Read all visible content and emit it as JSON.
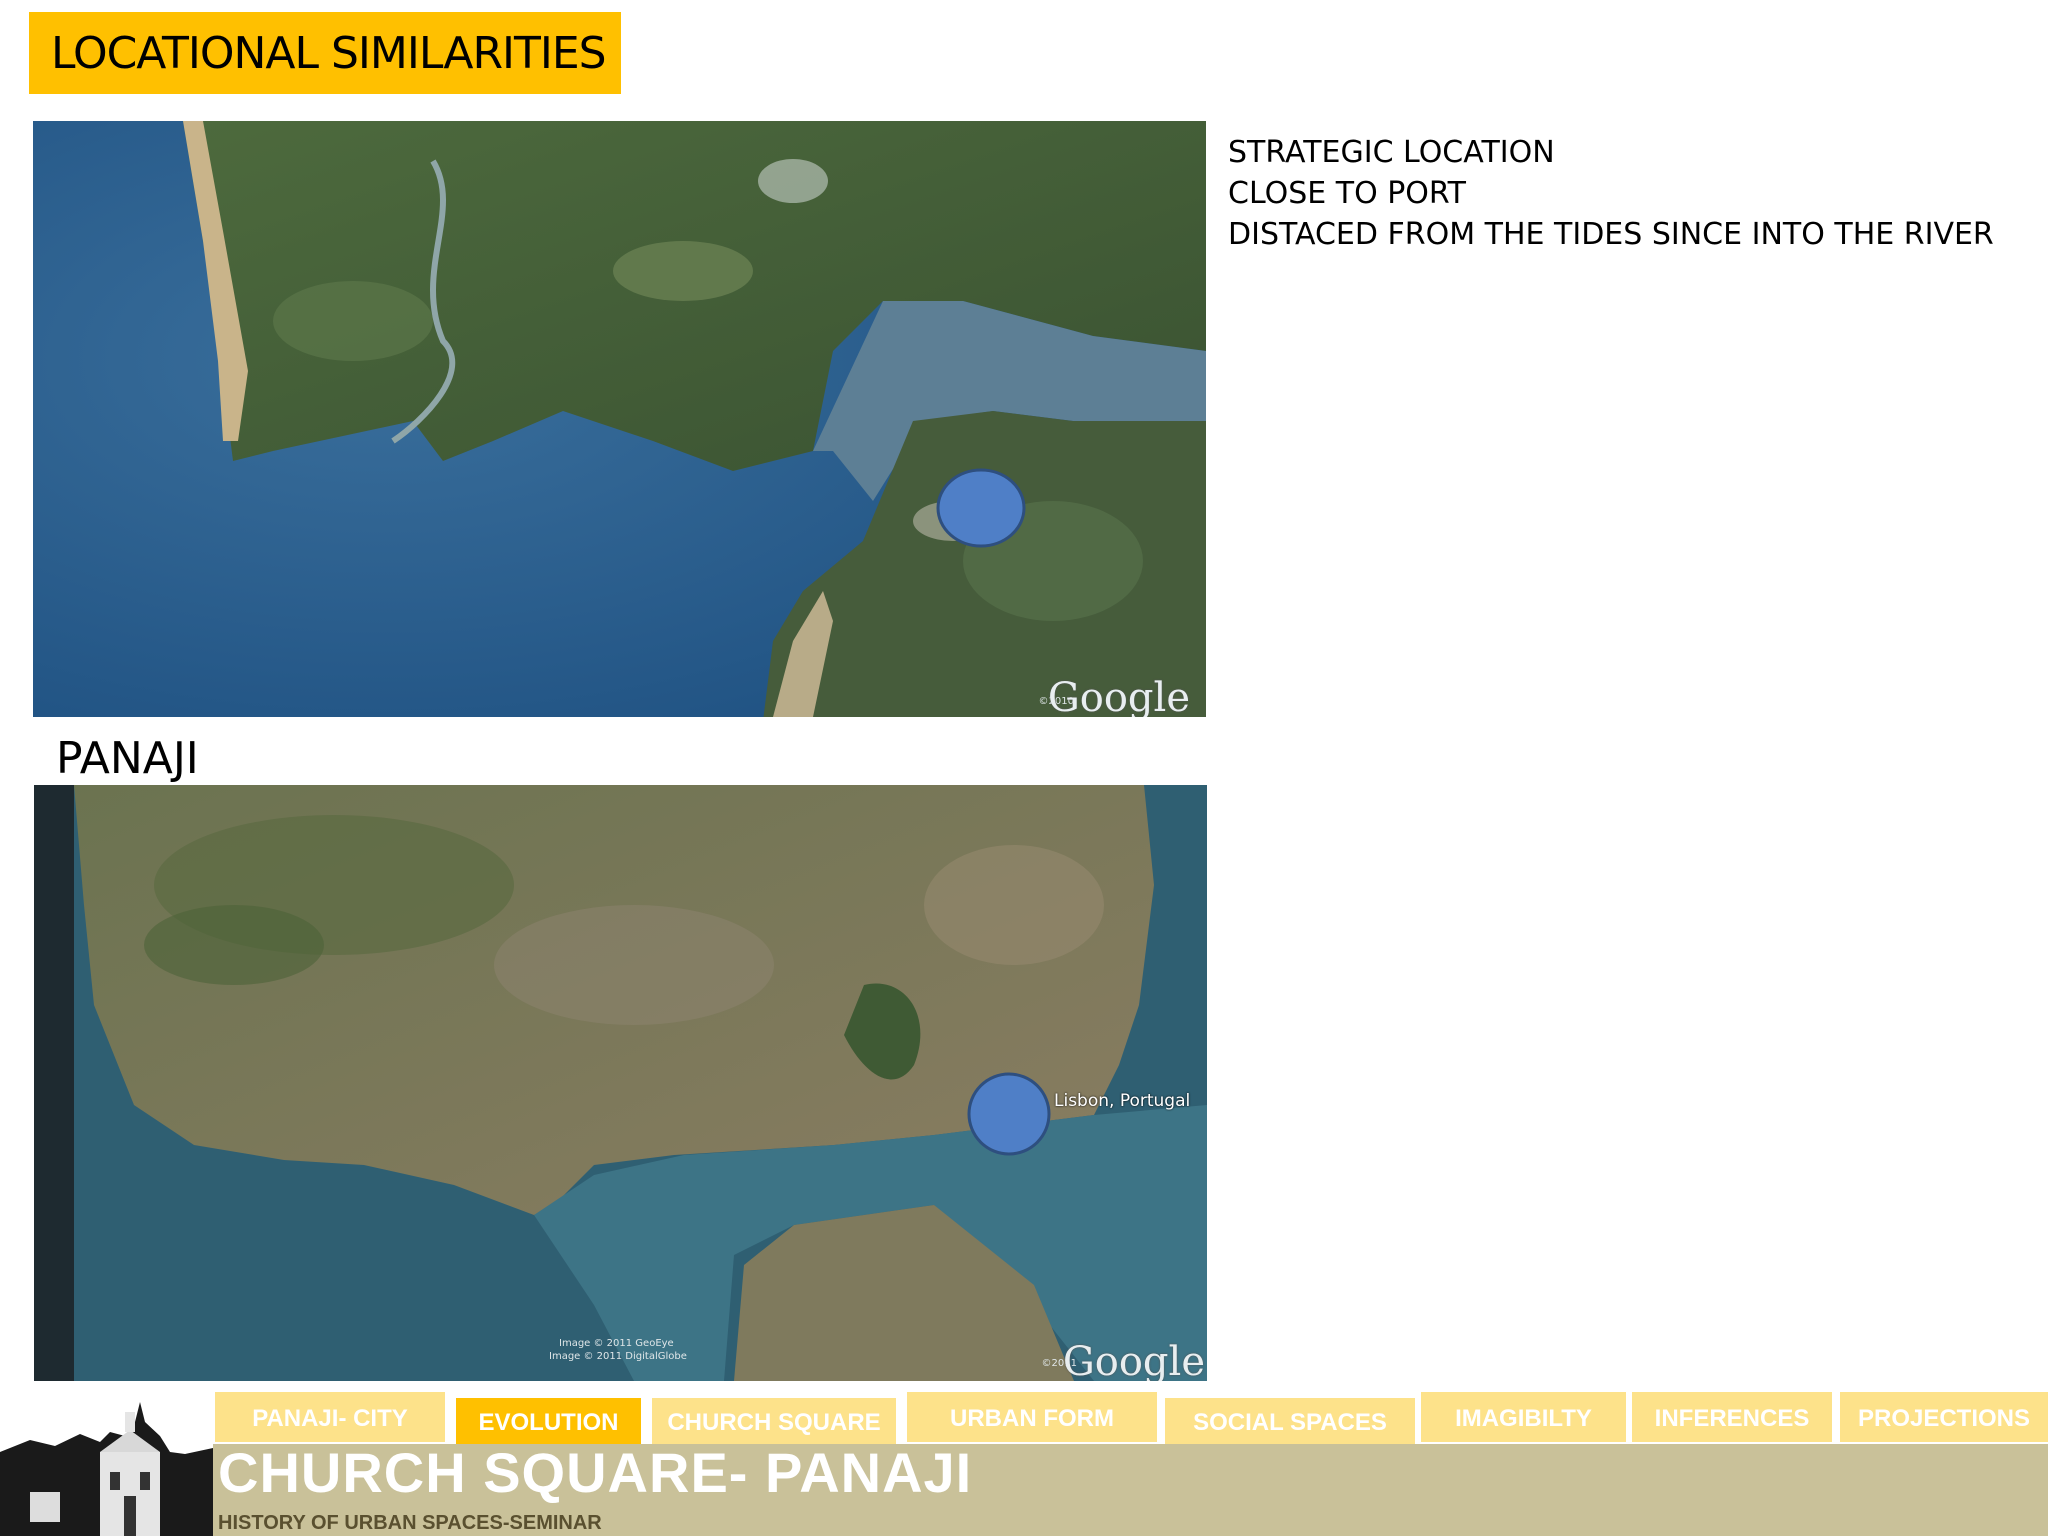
{
  "slide": {
    "title": "LOCATIONAL SIMILARITIES",
    "map_top_label": "PANAJI",
    "notes": [
      "STRATEGIC LOCATION",
      "CLOSE TO PORT",
      "DISTACED FROM THE TIDES SINCE INTO THE RIVER"
    ]
  },
  "map_top": {
    "credit": "Google",
    "credit_year": "©2010"
  },
  "map_bottom": {
    "place_label": "Lisbon, Portugal",
    "credit": "Google",
    "credit_year": "©2011",
    "image_credits": [
      "Image © 2011 GeoEye",
      "Image © 2011 DigitalGlobe"
    ]
  },
  "footer": {
    "tabs": [
      {
        "label": "PANAJI- CITY",
        "active": false
      },
      {
        "label": "EVOLUTION",
        "active": true
      },
      {
        "label": "CHURCH SQUARE",
        "active": false
      },
      {
        "label": "URBAN FORM",
        "active": false
      },
      {
        "label": "SOCIAL SPACES",
        "active": false
      },
      {
        "label": "IMAGIBILTY",
        "active": false
      },
      {
        "label": "INFERENCES",
        "active": false
      },
      {
        "label": "PROJECTIONS",
        "active": false
      }
    ],
    "title": "CHURCH SQUARE- PANAJI",
    "subtitle": "HISTORY OF URBAN SPACES-SEMINAR"
  },
  "colors": {
    "header_bg": "#ffc000",
    "tab_bg": "#fde28a",
    "tab_active_bg": "#ffc000",
    "footer_band": "#c9c199",
    "marker": "#4f7fc7"
  },
  "icons": [
    "church-photo"
  ]
}
